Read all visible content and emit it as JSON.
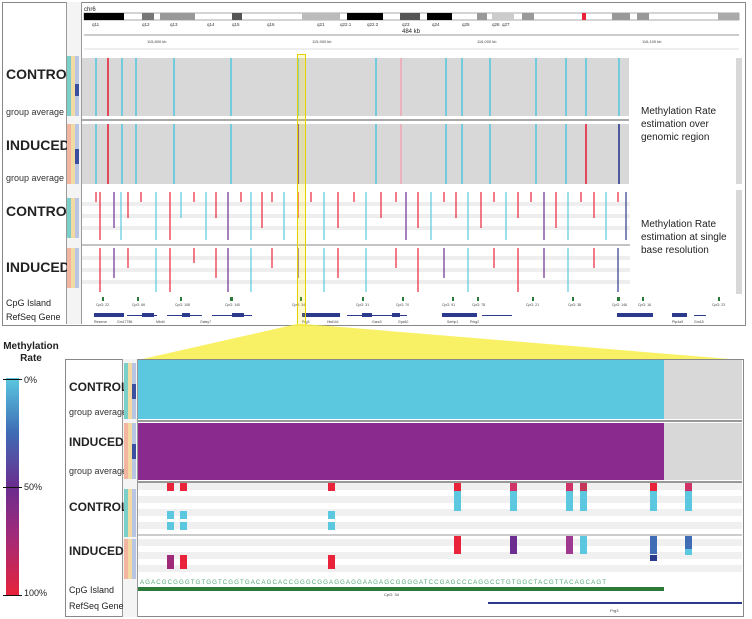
{
  "top": {
    "chromosome": "chr6",
    "bands": [
      "q11",
      "q12",
      "q13",
      "q14",
      "q15",
      "q16",
      "q21",
      "q22.1",
      "q22.2",
      "q23",
      "q24",
      "q25",
      "q26",
      "q27"
    ],
    "span_label": "484 kb",
    "coords": [
      "115,800 kb",
      "115,900 kb",
      "116,000 kb",
      "116,100 kb"
    ],
    "control_label": "CONTROL",
    "induced_label": "INDUCED",
    "group_average": "group average",
    "desc_region": "Methylation Rate estimation over genomic region",
    "desc_single": "Methylation Rate estimation at single base resolution",
    "cpg_label": "CpG Island",
    "refseq_label": "RefSeq Gene",
    "cpg_items": [
      "CpG: 22",
      "CpG: 66",
      "CpG: 108",
      "CpG: 140",
      "CpG: 34",
      "CpG: 31",
      "CpG: 70",
      "CpG: 91",
      "CpG: 78",
      "CpG: 21",
      "CpG: 38",
      "CpG: 146",
      "CpG: 16",
      "CpG: 23"
    ],
    "gene_items": [
      "Reserve",
      "Gm17786",
      "Mbd4",
      "Gatsy7",
      "Prg3",
      "Hist1h1",
      "Gars3",
      "Gpx60",
      "Serbp1",
      "Prkg2",
      "Ptp4a3",
      "Gm18"
    ]
  },
  "legend": {
    "title": "Methylation Rate",
    "ticks": [
      "0%",
      "50%",
      "100%"
    ],
    "colors": {
      "low": "#5bc8e0",
      "mid": "#6b2d8f",
      "high": "#e8233a"
    }
  },
  "bottom": {
    "control_label": "CONTROL",
    "induced_label": "INDUCED",
    "group_average": "group average",
    "cpg_label": "CpG Island",
    "refseq_label": "RefSeq Gene",
    "cpg_item": "CpG: 34",
    "gene_item": "Prg3",
    "sequence": "AGACGCGGGTGTGGTCGGTGACAGCACCGGGCGGAGGAGGAAGAGCGGGGATCCGAGCCCAGGCCTGTGGCTACGTTACAGCAGT"
  },
  "colors": {
    "control_avg": "#5bc8e0",
    "induced_avg": "#8b2a8e",
    "highlight": "#f2e600",
    "cpg_green": "#2c7a3a",
    "gene_navy": "#2b3a8c"
  }
}
